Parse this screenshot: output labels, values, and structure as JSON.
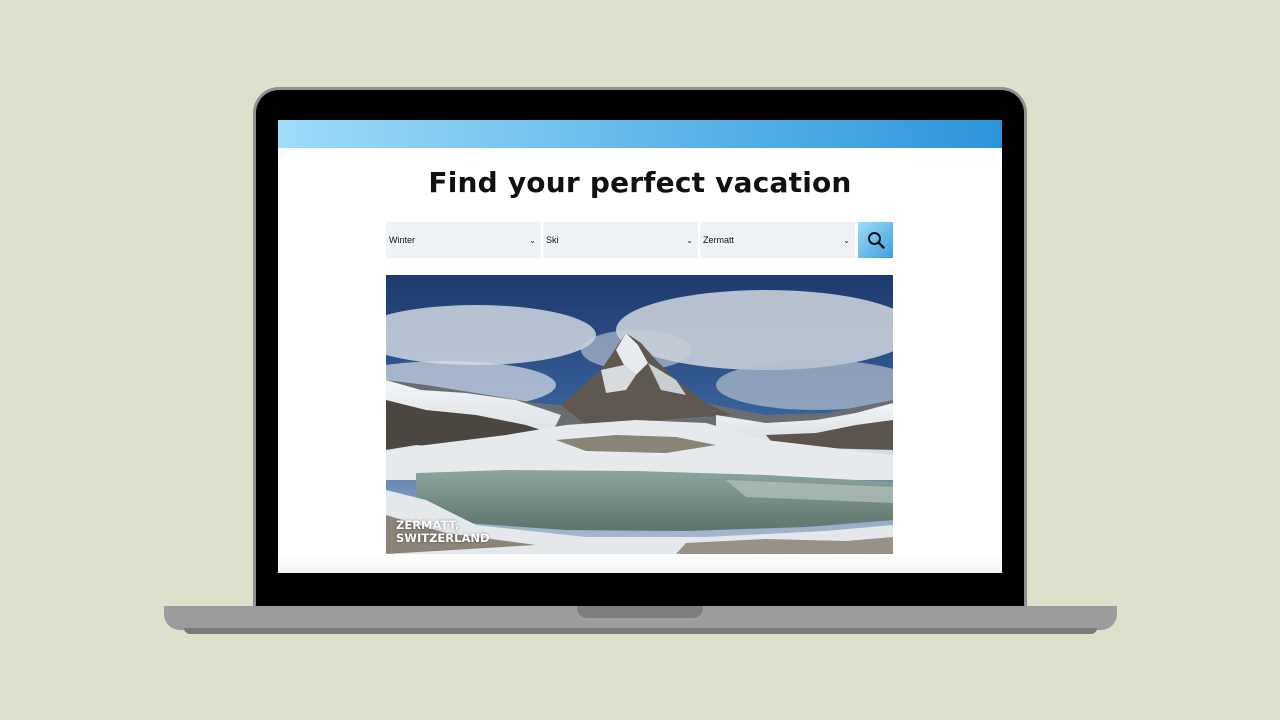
{
  "page": {
    "title": "Find your perfect vacation",
    "filters": {
      "season": "Winter",
      "activity": "Ski",
      "destination": "Zermatt"
    },
    "search_icon": "search-icon",
    "hero": {
      "caption_line1": "ZERMATT,",
      "caption_line2": "SWITZERLAND"
    }
  },
  "colors": {
    "background": "#dfe0cc",
    "header_gradient_start": "#9fdcf8",
    "header_gradient_end": "#2c95da",
    "select_bg": "#eff2f5"
  }
}
